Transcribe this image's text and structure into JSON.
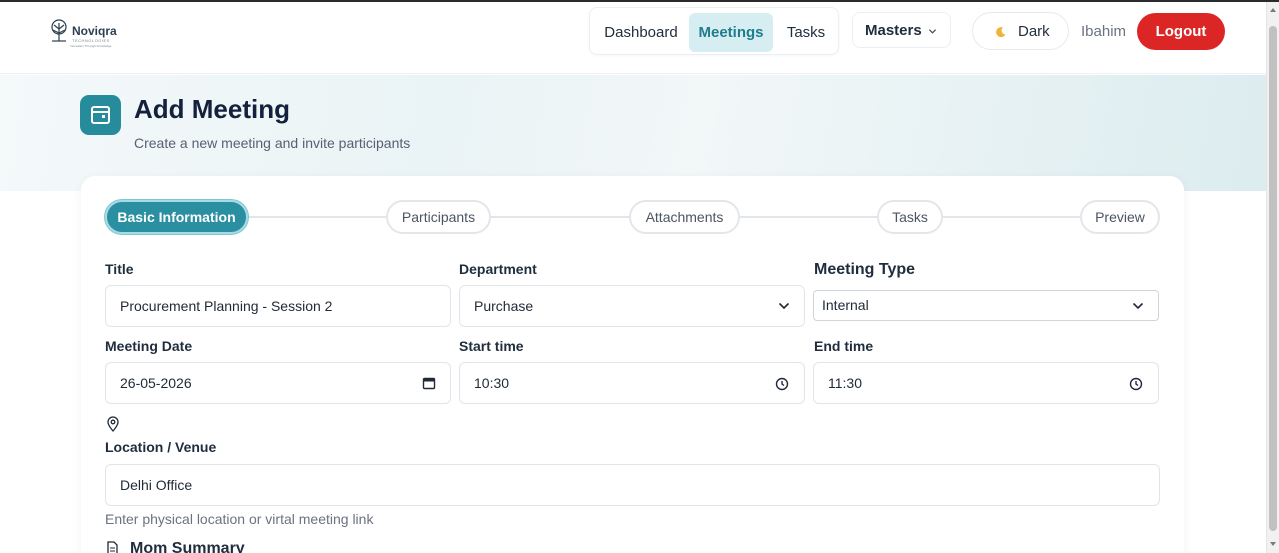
{
  "brand": {
    "name": "Noviqra",
    "tagline_1": "TECHNOLOGIES",
    "tagline_2": "Innovation Through Knowledge"
  },
  "nav": {
    "items": [
      {
        "label": "Dashboard",
        "active": false
      },
      {
        "label": "Meetings",
        "active": true
      },
      {
        "label": "Tasks",
        "active": false
      }
    ],
    "masters_label": "Masters",
    "theme_label": "Dark",
    "username": "Ibahim",
    "logout_label": "Logout"
  },
  "page": {
    "title": "Add Meeting",
    "subtitle": "Create a new meeting and invite participants",
    "icon": "calendar-icon"
  },
  "stepper": {
    "steps": [
      {
        "label": "Basic Information",
        "active": true
      },
      {
        "label": "Participants",
        "active": false
      },
      {
        "label": "Attachments",
        "active": false
      },
      {
        "label": "Tasks",
        "active": false
      },
      {
        "label": "Preview",
        "active": false
      }
    ]
  },
  "form": {
    "title": {
      "label": "Title",
      "value": "Procurement Planning - Session 2"
    },
    "department": {
      "label": "Department",
      "value": "Purchase"
    },
    "meeting_type": {
      "label": "Meeting Type",
      "value": "Internal"
    },
    "meeting_date": {
      "label": "Meeting Date",
      "value": "26-05-2026"
    },
    "start_time": {
      "label": "Start time",
      "value": "10:30"
    },
    "end_time": {
      "label": "End time",
      "value": "11:30"
    },
    "location": {
      "label": "Location / Venue",
      "value": "Delhi Office",
      "hint": "Enter physical location or virtal meeting link"
    },
    "mom_summary": {
      "label": "Mom Summary"
    }
  },
  "colors": {
    "accent": "#2a8fa0",
    "logout": "#dc2626",
    "active_nav_bg": "#d6eef2"
  }
}
